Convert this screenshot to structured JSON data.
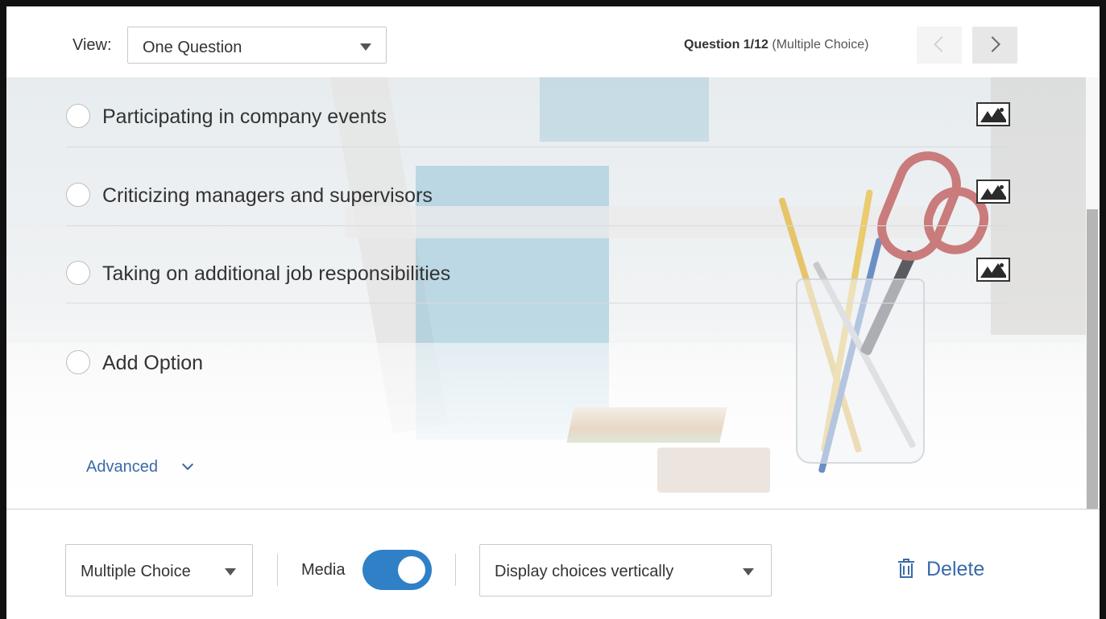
{
  "header": {
    "view_label": "View:",
    "view_select_value": "One Question",
    "question_position": "Question 1/12",
    "question_type": "(Multiple Choice)"
  },
  "options": [
    {
      "label": "Participating in company events",
      "has_media_icon": true
    },
    {
      "label": "Criticizing managers and supervisors",
      "has_media_icon": true
    },
    {
      "label": "Taking on additional job responsibilities",
      "has_media_icon": true
    },
    {
      "label": "Add Option",
      "has_media_icon": false
    }
  ],
  "advanced_label": "Advanced",
  "footer": {
    "question_type_value": "Multiple Choice",
    "media_label": "Media",
    "media_enabled": true,
    "display_value": "Display choices vertically",
    "delete_label": "Delete"
  },
  "colors": {
    "accent": "#2f80c7",
    "link": "#3a6aa8",
    "frame": "#111111"
  },
  "icons": {
    "view_caret": "caret-down-icon",
    "prev": "chevron-left-icon",
    "next": "chevron-right-icon",
    "option_media": "image-icon",
    "advanced": "chevron-down-icon",
    "delete": "trash-icon"
  }
}
